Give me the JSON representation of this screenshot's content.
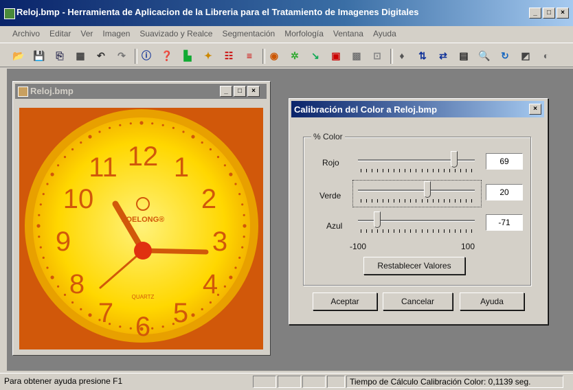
{
  "app": {
    "title": "Reloj.bmp - Herramienta de Aplicacion de la Libreria para el Tratamiento de Imagenes Digitales",
    "window_controls": [
      "_",
      "□",
      "×"
    ]
  },
  "menu": [
    "Archivo",
    "Editar",
    "Ver",
    "Imagen",
    "Suavizado y Realce",
    "Segmentación",
    "Morfología",
    "Ventana",
    "Ayuda"
  ],
  "toolbar": {
    "icons": [
      "open-icon",
      "save-icon",
      "copy-icon",
      "print-icon",
      "undo-icon",
      "redo-icon",
      "info-icon",
      "help-icon",
      "histogram-icon",
      "color-icon",
      "equalize-icon",
      "bands-icon",
      "palette-icon",
      "noise-icon",
      "arrow-icon",
      "layers-icon",
      "filter-icon",
      "edge-icon",
      "morph-icon",
      "vertical-flip-icon",
      "horizontal-flip-icon",
      "calc-icon",
      "zoom-icon",
      "rotate-icon",
      "crop-icon",
      "extra-icon"
    ],
    "glyphs": [
      "📂",
      "💾",
      "⎘",
      "▦",
      "↶",
      "↷",
      "ⓘ",
      "❓",
      "▙",
      "✦",
      "☷",
      "≡",
      "◉",
      "✲",
      "↘",
      "▣",
      "▩",
      "⊡",
      "♦",
      "⇅",
      "⇄",
      "▤",
      "🔍",
      "↻",
      "◩",
      "◐"
    ]
  },
  "child_window": {
    "title": "Reloj.bmp",
    "controls": [
      "_",
      "□",
      "×"
    ],
    "clock": {
      "numbers": [
        "12",
        "1",
        "2",
        "3",
        "4",
        "5",
        "6",
        "7",
        "8",
        "9",
        "10",
        "11"
      ],
      "brand": "LOELONG®",
      "quartz": "QUARTZ"
    }
  },
  "dialog": {
    "title": "Calibración del Color a Reloj.bmp",
    "close": "×",
    "group_label": "% Color",
    "sliders": [
      {
        "label": "Rojo",
        "value": "69",
        "fraction": 0.845
      },
      {
        "label": "Verde",
        "value": "20",
        "fraction": 0.6
      },
      {
        "label": "Azul",
        "value": "-71",
        "fraction": 0.145
      }
    ],
    "scale_min": "-100",
    "scale_max": "100",
    "reset_label": "Restablecer Valores",
    "buttons": {
      "accept": "Aceptar",
      "cancel": "Cancelar",
      "help": "Ayuda"
    }
  },
  "status": {
    "help_text": "Para obtener ayuda presione F1",
    "calc_text": "Tiempo de Cálculo Calibración Color: 0,1139 seg."
  },
  "colors": {
    "image_background": "#d1580a",
    "clock_face": "#ffd700",
    "clock_numbers": "#d1580a"
  }
}
